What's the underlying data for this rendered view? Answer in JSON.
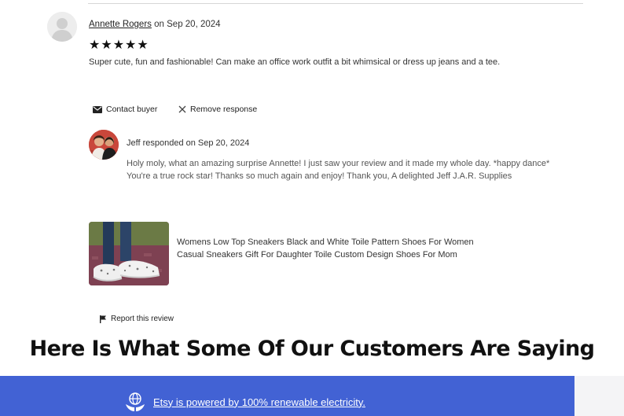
{
  "review": {
    "reviewer_name": "Annette Rogers",
    "date_prefix": "on",
    "date": "Sep 20, 2024",
    "rating_stars": "★★★★★",
    "rating_value": 5,
    "text": "Super cute, fun and fashionable! Can make an office work outfit a bit whimsical or dress up jeans and a tee."
  },
  "actions": {
    "contact_label": "Contact buyer",
    "remove_label": "Remove response",
    "report_label": "Report this review"
  },
  "response": {
    "header": "Jeff responded on Sep 20, 2024",
    "text": "Holy moly, what an amazing surprise Annette! I just saw your review and it made my whole day. *happy dance* You're a true rock star! Thanks so much again and enjoy! Thank you, A delighted Jeff J.A.R. Supplies"
  },
  "product": {
    "title": "Womens Low Top Sneakers Black and White Toile Pattern Shoes For Women Casual Sneakers Gift For Daughter Toile Custom Design Shoes For Mom"
  },
  "headline": "Here Is What Some Of Our Customers Are Saying",
  "footer": {
    "text": "Etsy is powered by 100% renewable electricity.",
    "bar_color": "#4262d4"
  },
  "icons": {
    "envelope": "envelope-icon",
    "close": "close-icon",
    "flag": "flag-icon",
    "globe": "globe-icon"
  }
}
